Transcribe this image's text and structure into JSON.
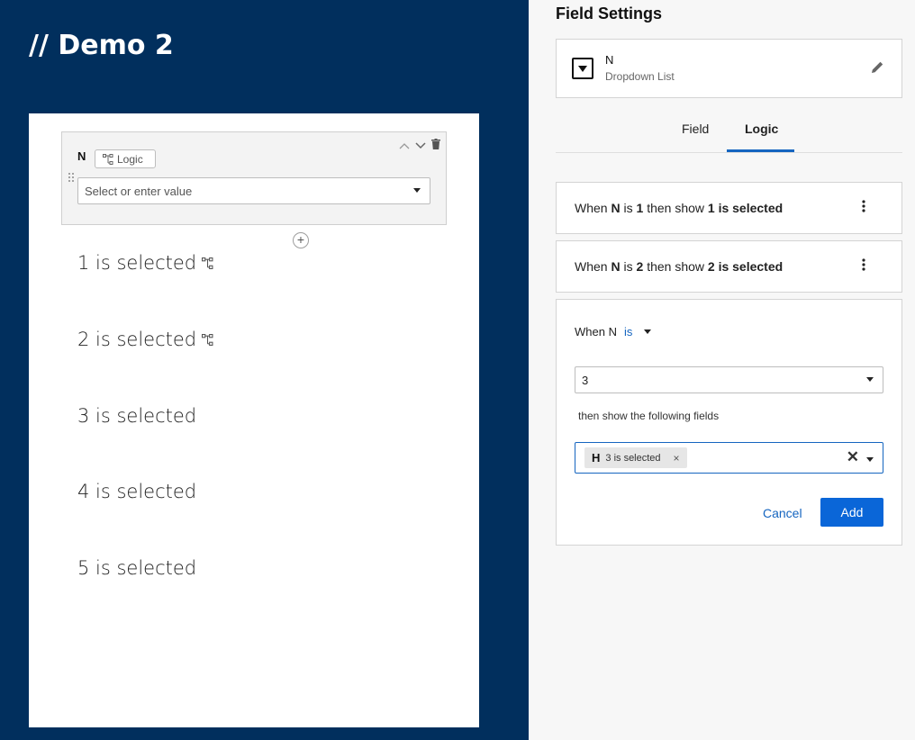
{
  "demo": {
    "title": "// Demo 2",
    "field": {
      "label": "N",
      "logic_chip": "Logic",
      "placeholder": "Select or enter value"
    },
    "selected_texts": [
      {
        "text": "1 is selected",
        "has_logic_icon": true
      },
      {
        "text": "2 is selected",
        "has_logic_icon": true
      },
      {
        "text": "3 is selected",
        "has_logic_icon": false
      },
      {
        "text": "4 is selected",
        "has_logic_icon": false
      },
      {
        "text": "5 is selected",
        "has_logic_icon": false
      }
    ]
  },
  "settings": {
    "title": "Field Settings",
    "field_name": "N",
    "field_type": "Dropdown List",
    "tabs": [
      "Field",
      "Logic"
    ],
    "active_tab": "Logic",
    "rules": [
      {
        "when": "When",
        "field": "N",
        "is": "is",
        "value": "1",
        "then_show": "then show",
        "target": "1 is selected"
      },
      {
        "when": "When",
        "field": "N",
        "is": "is",
        "value": "2",
        "then_show": "then show",
        "target": "2 is selected"
      }
    ],
    "editor": {
      "when_label": "When N",
      "operator": "is",
      "value": "3",
      "then_label": "then show the following fields",
      "tag_letter": "H",
      "tag_label": "3 is selected",
      "tag_remove": "×",
      "clear": "✕",
      "cancel_label": "Cancel",
      "add_label": "Add"
    }
  },
  "colors": {
    "left_bg": "#012f5d",
    "accent": "#1565c0",
    "primary_button": "#0a66d8"
  }
}
